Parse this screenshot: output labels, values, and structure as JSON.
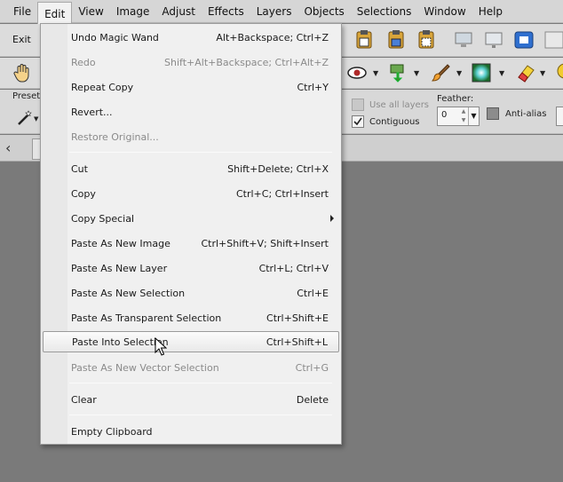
{
  "menubar": {
    "items": [
      "File",
      "Edit",
      "View",
      "Image",
      "Adjust",
      "Effects",
      "Layers",
      "Objects",
      "Selections",
      "Window",
      "Help"
    ]
  },
  "toolbar": {
    "exit_label": "Exit"
  },
  "tool_options": {
    "presets_label": "Presets",
    "use_all_layers_label": "Use all layers",
    "contiguous_label": "Contiguous",
    "feather_label": "Feather:",
    "feather_value": "0",
    "anti_alias_label": "Anti-alias"
  },
  "edit_menu": {
    "items": [
      {
        "label": "Undo Magic Wand",
        "shortcut": "Alt+Backspace; Ctrl+Z",
        "enabled": true
      },
      {
        "label": "Redo",
        "shortcut": "Shift+Alt+Backspace; Ctrl+Alt+Z",
        "enabled": false
      },
      {
        "label": "Repeat  Copy",
        "shortcut": "Ctrl+Y",
        "enabled": true
      },
      {
        "label": "Revert...",
        "shortcut": "",
        "enabled": true
      },
      {
        "label": "Restore Original...",
        "shortcut": "",
        "enabled": false
      },
      {
        "label": "Cut",
        "shortcut": "Shift+Delete; Ctrl+X",
        "enabled": true
      },
      {
        "label": "Copy",
        "shortcut": "Ctrl+C; Ctrl+Insert",
        "enabled": true
      },
      {
        "label": "Copy Special",
        "shortcut": "",
        "enabled": true,
        "submenu": true
      },
      {
        "label": "Paste As New Image",
        "shortcut": "Ctrl+Shift+V; Shift+Insert",
        "enabled": true
      },
      {
        "label": "Paste As New Layer",
        "shortcut": "Ctrl+L; Ctrl+V",
        "enabled": true
      },
      {
        "label": "Paste As New Selection",
        "shortcut": "Ctrl+E",
        "enabled": true
      },
      {
        "label": "Paste As Transparent Selection",
        "shortcut": "Ctrl+Shift+E",
        "enabled": true
      },
      {
        "label": "Paste Into Selection",
        "shortcut": "Ctrl+Shift+L",
        "enabled": true,
        "highlighted": true
      },
      {
        "label": "Paste As New Vector Selection",
        "shortcut": "Ctrl+G",
        "enabled": false
      },
      {
        "label": "Clear",
        "shortcut": "Delete",
        "enabled": true
      },
      {
        "label": "Empty Clipboard",
        "shortcut": "",
        "enabled": true
      }
    ]
  },
  "colors": {
    "menu_bg": "#f0f0f0",
    "toolbar_bg": "#dcdcdc",
    "workspace_bg": "#7a7a7a",
    "disabled_text": "#8a8a8a"
  }
}
